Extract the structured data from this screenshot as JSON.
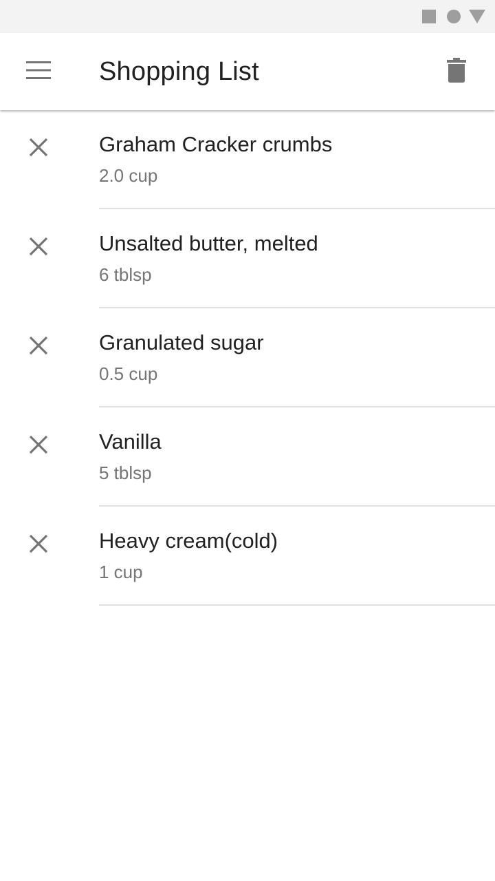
{
  "status_bar": {
    "icons": [
      "square-icon",
      "circle-icon",
      "triangle-icon"
    ]
  },
  "app_bar": {
    "menu_icon": "hamburger-menu-icon",
    "title": "Shopping List",
    "action_icon": "trash-icon"
  },
  "colors": {
    "text_primary": "#212121",
    "text_secondary": "#757575",
    "icon": "#757575",
    "divider": "#e0e0e0",
    "status_bar_bg": "#f3f3f3"
  },
  "items": [
    {
      "name": "Graham Cracker crumbs",
      "quantity": "2.0 cup"
    },
    {
      "name": "Unsalted butter, melted",
      "quantity": "6 tblsp"
    },
    {
      "name": "Granulated sugar",
      "quantity": "0.5 cup"
    },
    {
      "name": "Vanilla",
      "quantity": "5 tblsp"
    },
    {
      "name": "Heavy cream(cold)",
      "quantity": "1 cup"
    }
  ]
}
